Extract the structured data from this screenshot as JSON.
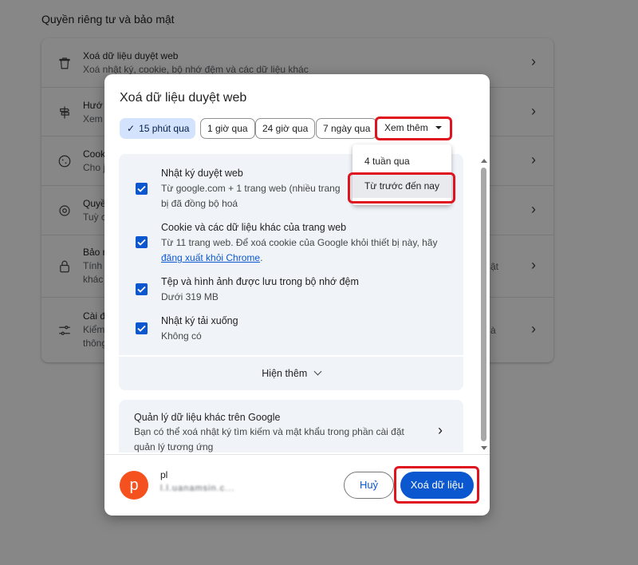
{
  "page": {
    "section_title": "Quyền riêng tư và bảo mật",
    "rows": [
      {
        "icon": "trash-icon",
        "title": "Xoá dữ liệu duyệt web",
        "desc": "Xoá nhật ký, cookie, bộ nhớ đệm và các dữ liệu khác",
        "right": ""
      },
      {
        "icon": "signpost-icon",
        "title": "Hướ",
        "desc": "Xem",
        "right": ""
      },
      {
        "icon": "cookie-icon",
        "title": "Cook",
        "desc": "Cho j",
        "right": ""
      },
      {
        "icon": "privacy-icon",
        "title": "Quyề",
        "desc": "Tuỳ c",
        "right": ""
      },
      {
        "icon": "lock-icon",
        "title": "Bảo m",
        "desc": "Tính",
        "desc2": "khác",
        "right": "ật"
      },
      {
        "icon": "tune-icon",
        "title": "Cài đ",
        "desc": "Kiểm",
        "desc2": "thông",
        "right": "à"
      }
    ]
  },
  "dialog": {
    "title": "Xoá dữ liệu duyệt web",
    "chips": [
      {
        "label": "15 phút qua",
        "selected": true
      },
      {
        "label": "1 giờ qua",
        "selected": false
      },
      {
        "label": "24 giờ qua",
        "selected": false
      },
      {
        "label": "7 ngày qua",
        "selected": false
      }
    ],
    "more_label": "Xem thêm",
    "dropdown": [
      "4 tuần qua",
      "Từ trước đến nay"
    ],
    "items": [
      {
        "title": "Nhật ký duyệt web",
        "desc1": "Từ google.com + 1 trang web (nhiều trang",
        "desc2": "bị đã đồng bộ hoá",
        "checked": true
      },
      {
        "title": "Cookie và các dữ liệu khác của trang web",
        "desc1": "Từ 11 trang web. Để xoá cookie của Google khỏi thiết bị này, hãy",
        "desc2_link": "đăng xuất khỏi Chrome",
        "desc2_suffix": ".",
        "checked": true
      },
      {
        "title": "Tệp và hình ảnh được lưu trong bộ nhớ đệm",
        "desc1": "Dưới 319 MB",
        "checked": true
      },
      {
        "title": "Nhật ký tải xuống",
        "desc1": "Không có",
        "checked": true
      }
    ],
    "show_more": "Hiện thêm",
    "manage": {
      "title": "Quản lý dữ liệu khác trên Google",
      "desc1": "Bạn có thể xoá nhật ký tìm kiếm và mật khẩu trong phần cài đặt",
      "desc2": "quản lý tương ứng"
    },
    "account": {
      "initial": "p",
      "name": "pl",
      "email": "l.l.uanamsin.c..."
    },
    "cancel": "Huỷ",
    "confirm": "Xoá dữ liệu"
  },
  "colors": {
    "accent": "#0b57d0",
    "highlight": "#e0141e",
    "chip_selected": "#d3e3fd",
    "avatar": "#f4511e"
  }
}
